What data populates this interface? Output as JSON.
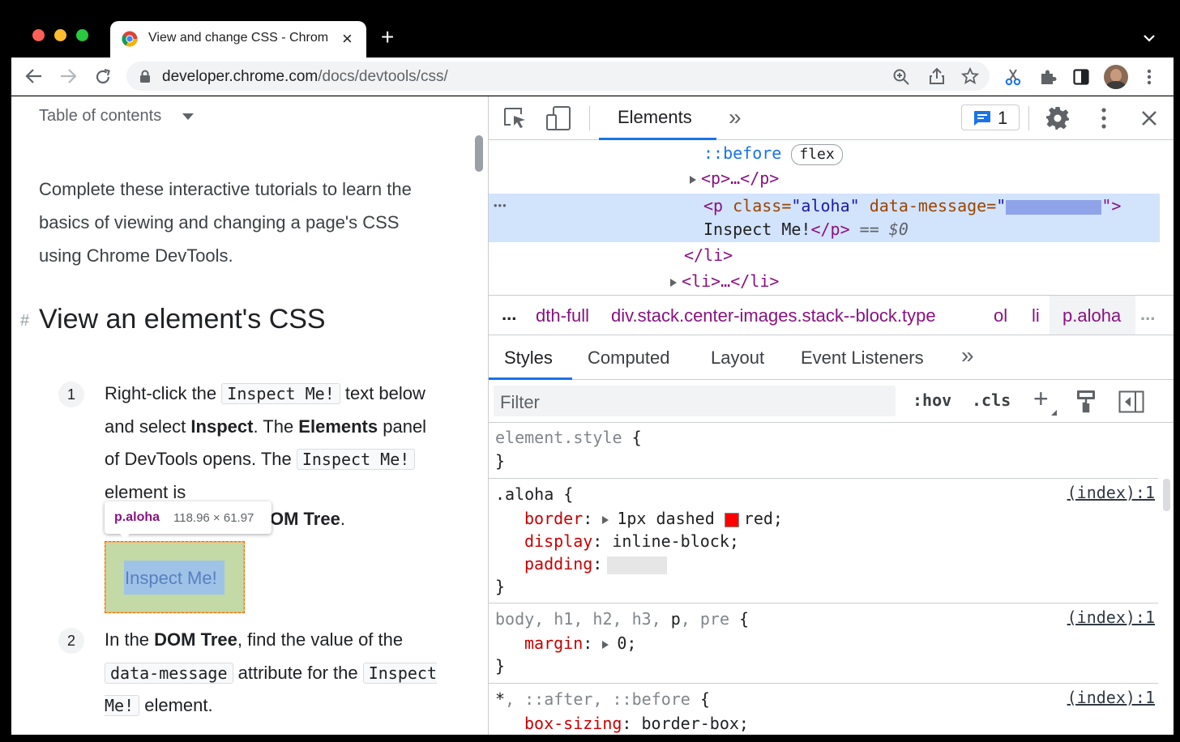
{
  "browser": {
    "tab_title": "View and change CSS - Chrom",
    "url_host": "developer.chrome.com",
    "url_path": "/docs/devtools/css/",
    "colors": {
      "close": "#ff5f57",
      "minimize": "#febc2e",
      "maximize": "#28c840",
      "accent": "#1a73e8"
    }
  },
  "page": {
    "toc_label": "Table of contents",
    "intro": "Complete these interactive tutorials to learn the basics of viewing and changing a page's CSS using Chrome DevTools.",
    "heading_hash": "#",
    "heading": "View an element's CSS",
    "step1": {
      "number": "1",
      "t1": "Right-click the ",
      "code1": "Inspect Me!",
      "t2": " text below and select ",
      "b1": "Inspect",
      "t3": ". The ",
      "b2": "Elements",
      "t4": " panel of DevTools opens. The ",
      "code2": "Inspect Me!",
      "t5": " element is",
      "t6_end": "OM Tree",
      "t6_dot": "."
    },
    "tooltip": {
      "selector": "p.aloha",
      "size": "118.96 × 61.97"
    },
    "inspect_box": "Inspect Me!",
    "step2": {
      "number": "2",
      "t1": "In the ",
      "b1": "DOM Tree",
      "t2": ", find the value of the ",
      "code1": "data-message",
      "t3": " attribute for the ",
      "code2": "Inspect Me!",
      "t4": " element."
    }
  },
  "devtools": {
    "main_tab": "Elements",
    "more_tabs": "»",
    "issues_count": "1",
    "dom": {
      "before_pseudo": "::before",
      "flex_badge": "flex",
      "p_collapsed": "<p>…</p>",
      "ellipsis": "•••",
      "sel_open_tag": "<p ",
      "sel_attr1_name": "class=",
      "sel_attr1_value": "\"aloha\"",
      "sel_attr2_name": "data-message=",
      "sel_attr2_quote_open": "\"",
      "sel_attr2_quote_close": "\">",
      "sel_text": "Inspect Me!",
      "sel_close": "</p>",
      "sel_eq": " == ",
      "sel_var": "$0",
      "li_close": "</li>",
      "li_collapsed": "<li>…</li>"
    },
    "breadcrumbs": {
      "more_left": "...",
      "items": [
        "dth-full",
        "div.stack.center-images.stack--block.type",
        "ol",
        "li",
        "p.aloha"
      ],
      "more_right": "..."
    },
    "subtabs": [
      "Styles",
      "Computed",
      "Layout",
      "Event Listeners"
    ],
    "subtabs_more": "»",
    "filter_placeholder": "Filter",
    "hov": ":hov",
    "cls": ".cls",
    "add": "+",
    "rules": {
      "element_style": {
        "selector": "element.style",
        "open": " {",
        "close": "}"
      },
      "aloha": {
        "selector": ".aloha",
        "open": " {",
        "source": "(index):1",
        "border_prop": "border",
        "border_value_pre": "1px dashed ",
        "border_color": "#ff0000",
        "border_value_post": "red;",
        "display_prop": "display",
        "display_value": "inline-block;",
        "padding_prop": "padding",
        "close": "}"
      },
      "body": {
        "selector_gray": "body, h1, h2, h3, ",
        "selector_p": "p",
        "selector_comma": ", ",
        "selector_pre": "pre",
        "open": " {",
        "source": "(index):1",
        "margin_prop": "margin",
        "margin_value": "0;",
        "close": "}"
      },
      "universal": {
        "selector_star": "*",
        "selector_rest": ", ::after, ::before",
        "open": " {",
        "source": "(index):1",
        "box_prop": "box-sizing",
        "box_value": "border-box;"
      }
    }
  }
}
